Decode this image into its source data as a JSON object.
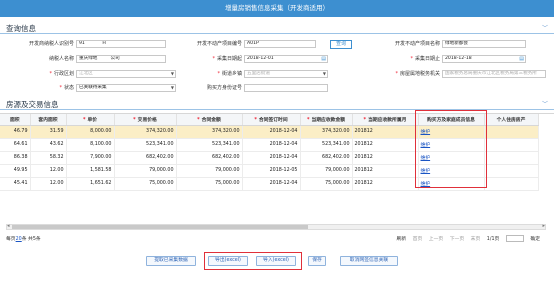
{
  "window": {
    "title": "增量房销售信息采集（开发商适用）"
  },
  "query": {
    "title": "查询信息",
    "fields": {
      "seller_tax_id": {
        "label": "开发商纳税人识别号",
        "value": "91            H"
      },
      "project_code": {
        "label": "开发不动产项目编号",
        "value": "A01P            "
      },
      "query_button": "查询",
      "project_name": {
        "label": "开发不动产项目名称",
        "value": "绿地新都会"
      },
      "taxpayer_name": {
        "label": "纳税人名称",
        "value": "重庆绿地         公司"
      },
      "date_start": {
        "label": "采集日期起",
        "value": "2018-12-01"
      },
      "date_end": {
        "label": "采集日期止",
        "value": "2018-12-18"
      },
      "district": {
        "label": "行政区划",
        "value": "江北区"
      },
      "street": {
        "label": "街道乡镇",
        "value": "五里店街道"
      },
      "tax_authority": {
        "label": "房屋属地税务机关",
        "value": "国家税务总局重庆市江北区税务局第三税务所"
      },
      "status": {
        "label": "状态",
        "value": "已关联待采集"
      },
      "cert_no": {
        "label": "购买方身份证号",
        "value": ""
      }
    }
  },
  "table": {
    "title": "房源及交易信息",
    "columns": [
      "面积",
      "套内面积",
      "单价",
      "交易价格",
      "合同金额",
      "合同签订时间",
      "当期应收款金额",
      "当期应收款所属月",
      "购买方及家庭成员信息",
      "个人住房房产"
    ],
    "required_columns": [
      false,
      false,
      true,
      true,
      true,
      true,
      true,
      true,
      false,
      false
    ],
    "rows": [
      [
        "46.79",
        "31.59",
        "8,000.00",
        "374,320.00",
        "374,320.00",
        "2018-12-04",
        "374,320.00",
        "201812",
        "维护",
        ""
      ],
      [
        "64.61",
        "43.62",
        "8,100.00",
        "523,341.00",
        "523,341.00",
        "2018-12-04",
        "523,341.00",
        "201812",
        "维护",
        ""
      ],
      [
        "86.38",
        "58.32",
        "7,900.00",
        "682,402.00",
        "682,402.00",
        "2018-12-04",
        "682,402.00",
        "201812",
        "维护",
        ""
      ],
      [
        "49.95",
        "12.00",
        "1,581.58",
        "79,000.00",
        "79,000.00",
        "2018-12-05",
        "79,000.00",
        "201812",
        "维护",
        ""
      ],
      [
        "45.41",
        "12.00",
        "1,651.62",
        "75,000.00",
        "75,000.00",
        "2018-12-04",
        "75,000.00",
        "201812",
        "维护",
        ""
      ]
    ],
    "selected_row": 0
  },
  "pager": {
    "per_page_prefix": "每页",
    "per_page": "20",
    "per_page_suffix": "条 共5条",
    "refresh": "刷新",
    "first": "首页",
    "prev": "上一页",
    "next": "下一页",
    "last": "末页",
    "page_info": "1/1页",
    "goto": "确定"
  },
  "actions": {
    "fetch": "提取已采集数据",
    "export": "导出(excel)",
    "import": "导入(excel)",
    "save": "保存",
    "cancel_link": "取消网签信息关联"
  },
  "colors": {
    "titlebar": "#3d8fd0",
    "highlight_box": "#e0303a",
    "selected_row": "#fbeec6",
    "link": "#1a55c4"
  }
}
